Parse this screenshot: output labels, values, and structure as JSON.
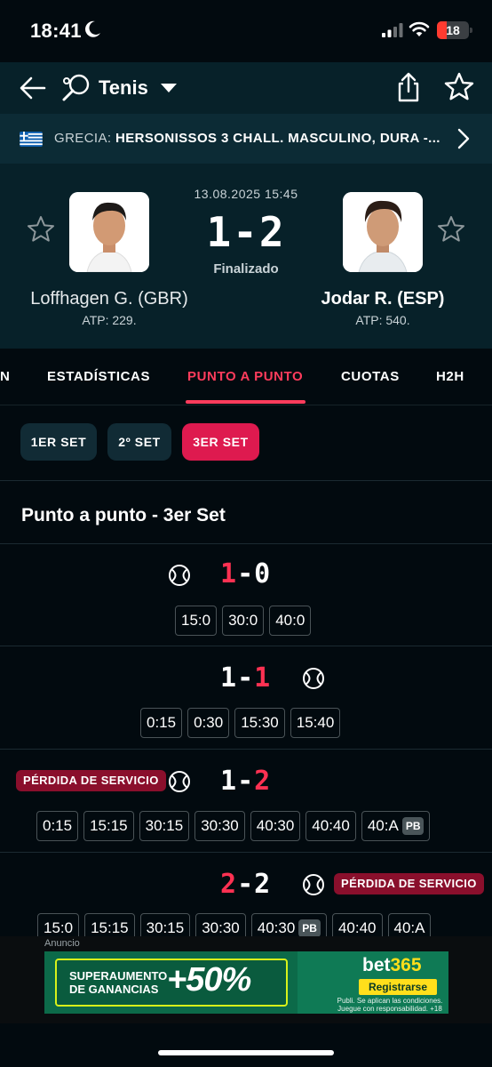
{
  "status_bar": {
    "time": "18:41",
    "battery": "18"
  },
  "nav": {
    "sport": "Tenis"
  },
  "league": {
    "country": "GRECIA:",
    "name": "HERSONISSOS 3 CHALL. MASCULINO, DURA -..."
  },
  "match": {
    "datetime": "13.08.2025 15:45",
    "score": "1-2",
    "status": "Finalizado",
    "home": {
      "name": "Loffhagen G. (GBR)",
      "rank": "ATP: 229."
    },
    "away": {
      "name": "Jodar R. (ESP)",
      "rank": "ATP: 540."
    }
  },
  "tabs": [
    {
      "label": "N"
    },
    {
      "label": "ESTADÍSTICAS"
    },
    {
      "label": "PUNTO A PUNTO"
    },
    {
      "label": "CUOTAS"
    },
    {
      "label": "H2H"
    }
  ],
  "sets": [
    "1ER SET",
    "2º SET",
    "3ER SET"
  ],
  "section_title": "Punto a punto - 3er Set",
  "games": [
    {
      "left": "1",
      "right": "0",
      "points": [
        "15:0",
        "30:0",
        "40:0"
      ]
    },
    {
      "left": "1",
      "right": "1",
      "points": [
        "0:15",
        "0:30",
        "15:30",
        "15:40"
      ]
    },
    {
      "left": "1",
      "right": "2",
      "break_label": "PÉRDIDA DE SERVICIO",
      "points": [
        "0:15",
        "15:15",
        "30:15",
        "30:30",
        "40:30",
        "40:40",
        "40:A"
      ],
      "pb_label": "PB"
    },
    {
      "left": "2",
      "right": "2",
      "break_label": "PÉRDIDA DE SERVICIO",
      "points": [
        "15:0",
        "15:15",
        "30:15",
        "30:30",
        "40:30",
        "40:40",
        "40:A"
      ],
      "pb_label": "PB"
    }
  ],
  "ad": {
    "label": "Anuncio",
    "line1": "SUPERAUMENTO",
    "line2": "DE GANANCIAS",
    "big": "+50%",
    "brand_a": "bet",
    "brand_b": "365",
    "cta": "Registrarse",
    "legal1": "Publi. Se aplican las condiciones.",
    "legal2": "Juegue con responsabilidad. +18"
  },
  "colors": {
    "accent": "#ff3c5c",
    "header_bg": "#072129",
    "break_bg": "#8a0f2c"
  }
}
